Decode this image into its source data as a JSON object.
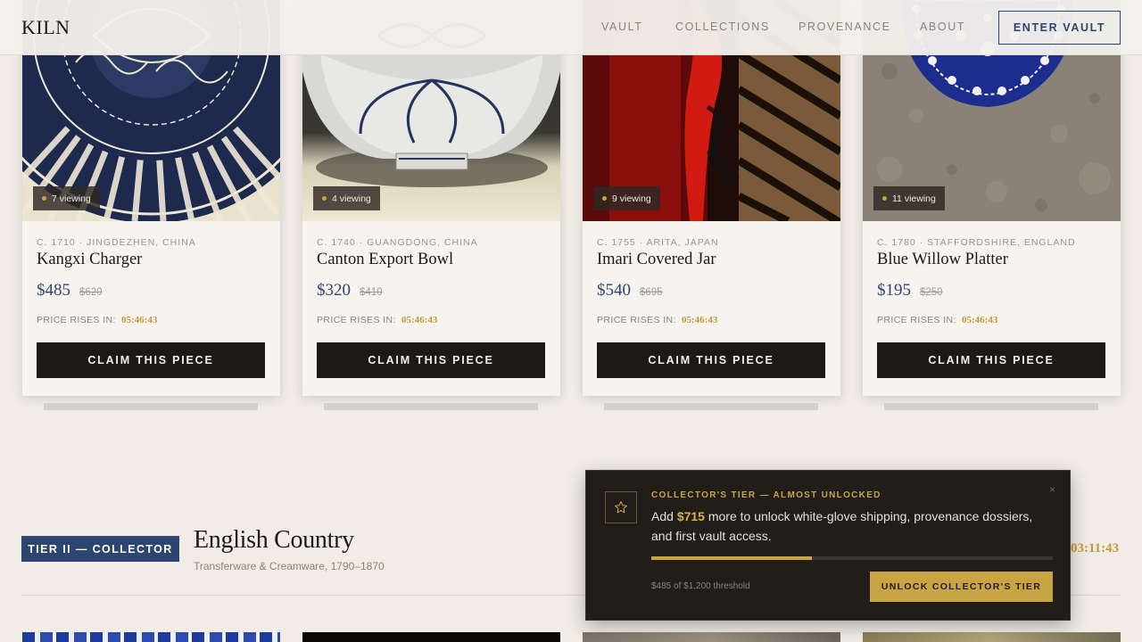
{
  "header": {
    "logo": "KILN",
    "nav": [
      "VAULT",
      "COLLECTIONS",
      "PROVENANCE",
      "ABOUT"
    ],
    "cta": "ENTER VAULT"
  },
  "products": [
    {
      "viewing": "7 viewing",
      "origin": "C. 1710 · JINGDEZHEN, CHINA",
      "name": "Kangxi Charger",
      "price": "$485",
      "old_price": "$620",
      "rise_label": "PRICE RISES IN:",
      "timer": "05:46:43",
      "cta": "CLAIM THIS PIECE"
    },
    {
      "viewing": "4 viewing",
      "origin": "C. 1740 · GUANGDONG, CHINA",
      "name": "Canton Export Bowl",
      "price": "$320",
      "old_price": "$410",
      "rise_label": "PRICE RISES IN:",
      "timer": "05:46:43",
      "cta": "CLAIM THIS PIECE"
    },
    {
      "viewing": "9 viewing",
      "origin": "C. 1755 · ARITA, JAPAN",
      "name": "Imari Covered Jar",
      "price": "$540",
      "old_price": "$695",
      "rise_label": "PRICE RISES IN:",
      "timer": "05:46:43",
      "cta": "CLAIM THIS PIECE"
    },
    {
      "viewing": "11 viewing",
      "origin": "C. 1780 · STAFFORDSHIRE, ENGLAND",
      "name": "Blue Willow Platter",
      "price": "$195",
      "old_price": "$250",
      "rise_label": "PRICE RISES IN:",
      "timer": "05:46:43",
      "cta": "CLAIM THIS PIECE"
    }
  ],
  "section": {
    "badge": "TIER II — COLLECTOR",
    "title": "English Country",
    "subtitle": "Transferware & Creamware, 1790–1870",
    "timer": "03:11:43"
  },
  "popup": {
    "eyebrow": "COLLECTOR'S TIER — ALMOST UNLOCKED",
    "body_prefix": "Add ",
    "amount": "$715",
    "body_suffix": " more to unlock white-glove shipping, provenance dossiers, and first vault access.",
    "progress_fraction": 0.4,
    "threshold": "$485 of $1,200 threshold",
    "cta": "UNLOCK COLLECTOR'S TIER",
    "close": "×"
  },
  "colors": {
    "accent_blue": "#2c4670",
    "gold": "#c9a443",
    "dark": "#1d1a16"
  },
  "icons": {
    "popup": "star-icon",
    "close": "close-icon"
  }
}
